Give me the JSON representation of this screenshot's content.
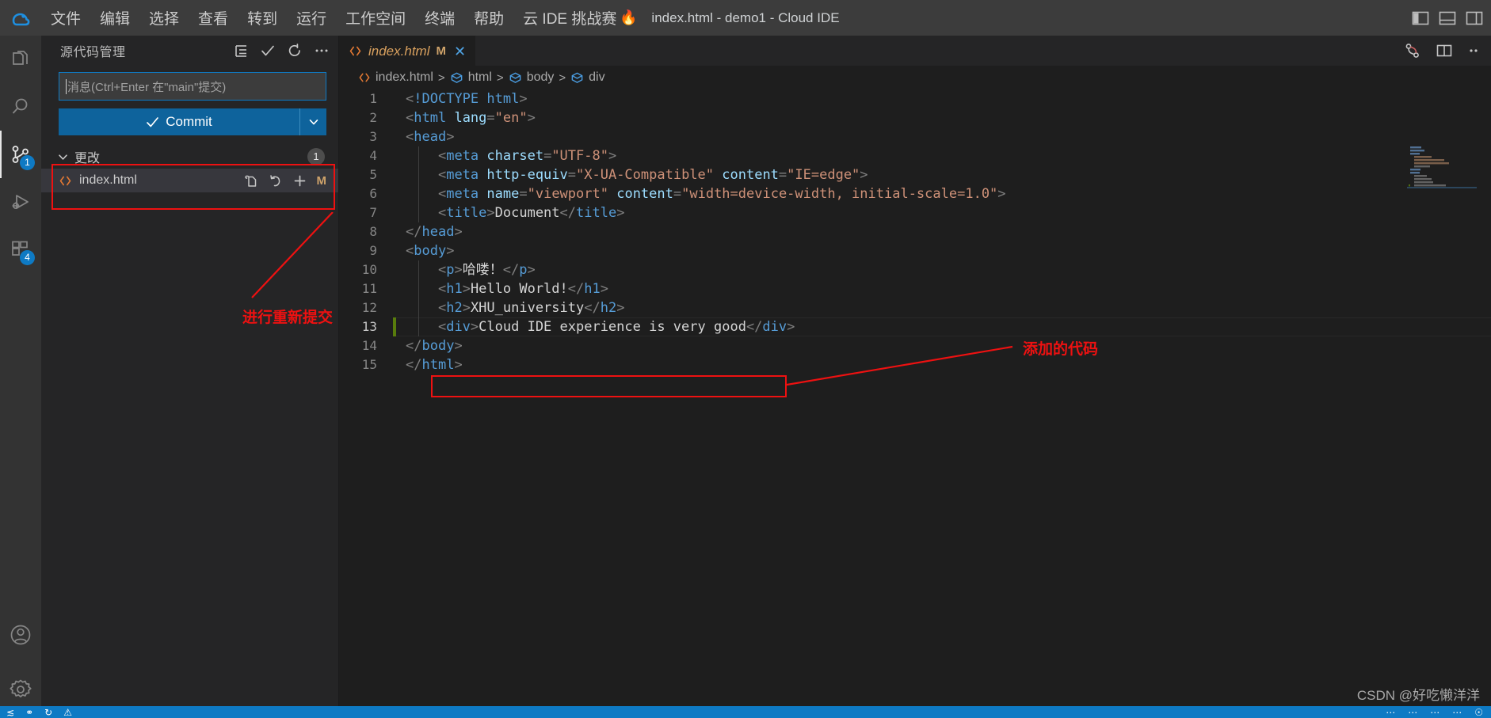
{
  "titlebar": {
    "logo_icon": "cloud-ide-logo",
    "menus": [
      "文件",
      "编辑",
      "选择",
      "查看",
      "转到",
      "运行",
      "工作空间",
      "终端",
      "帮助"
    ],
    "challenge_label": "云 IDE 挑战赛",
    "challenge_emoji": "🔥",
    "window_title": "index.html - demo1 - Cloud IDE",
    "layout_buttons": [
      "toggle-primary-sidebar-icon",
      "toggle-panel-icon",
      "toggle-secondary-sidebar-icon"
    ]
  },
  "activitybar": {
    "items": [
      {
        "name": "explorer",
        "icon": "files-icon",
        "badge": ""
      },
      {
        "name": "search",
        "icon": "search-icon",
        "badge": ""
      },
      {
        "name": "source-control",
        "icon": "source-control-icon",
        "badge": "1"
      },
      {
        "name": "run-debug",
        "icon": "run-debug-icon",
        "badge": ""
      },
      {
        "name": "extensions",
        "icon": "extensions-icon",
        "badge": "4"
      }
    ],
    "bottom": [
      {
        "name": "account",
        "icon": "account-icon"
      },
      {
        "name": "manage",
        "icon": "gear-icon"
      }
    ]
  },
  "sidebar": {
    "title": "源代码管理",
    "actions": [
      "view-as-tree-icon",
      "commit-check-icon",
      "refresh-icon",
      "more-actions-icon"
    ],
    "commit_input_placeholder": "消息(Ctrl+Enter 在\"main\"提交)",
    "commit_button_label": "Commit",
    "commit_dropdown_icon": "chevron-down-icon",
    "changes_group": {
      "label": "更改",
      "count": "1",
      "chevron": "chevron-down-icon"
    },
    "files": [
      {
        "name": "index.html",
        "icon": "html-file-icon",
        "actions": [
          "open-file-icon",
          "discard-changes-icon",
          "stage-changes-icon"
        ],
        "status_letter": "M"
      }
    ]
  },
  "editor": {
    "tab": {
      "icon": "html-file-icon",
      "label": "index.html",
      "status_letter": "M",
      "close_icon": "close-icon"
    },
    "tools": [
      "split-diff-icon",
      "split-editor-icon",
      "more-actions-icon"
    ],
    "breadcrumb": [
      {
        "label": "index.html",
        "icon": "html-file-icon"
      },
      {
        "label": "html",
        "icon": "symbol-cube-icon"
      },
      {
        "label": "body",
        "icon": "symbol-cube-icon"
      },
      {
        "label": "div",
        "icon": "symbol-cube-icon"
      }
    ],
    "separator": ">",
    "active_line": 13,
    "lines": [
      {
        "n": "1",
        "indent": 0,
        "modified": false,
        "tokens": [
          {
            "t": "br",
            "v": "<"
          },
          {
            "t": "doctype",
            "v": "!DOCTYPE html"
          },
          {
            "t": "br",
            "v": ">"
          }
        ]
      },
      {
        "n": "2",
        "indent": 0,
        "modified": false,
        "tokens": [
          {
            "t": "br",
            "v": "<"
          },
          {
            "t": "tag",
            "v": "html"
          },
          {
            "t": "txt",
            "v": " "
          },
          {
            "t": "attr",
            "v": "lang"
          },
          {
            "t": "br",
            "v": "="
          },
          {
            "t": "str",
            "v": "\"en\""
          },
          {
            "t": "br",
            "v": ">"
          }
        ]
      },
      {
        "n": "3",
        "indent": 0,
        "modified": false,
        "tokens": [
          {
            "t": "br",
            "v": "<"
          },
          {
            "t": "tag",
            "v": "head"
          },
          {
            "t": "br",
            "v": ">"
          }
        ]
      },
      {
        "n": "4",
        "indent": 1,
        "modified": false,
        "tokens": [
          {
            "t": "txt",
            "v": "    "
          },
          {
            "t": "br",
            "v": "<"
          },
          {
            "t": "tag",
            "v": "meta"
          },
          {
            "t": "txt",
            "v": " "
          },
          {
            "t": "attr",
            "v": "charset"
          },
          {
            "t": "br",
            "v": "="
          },
          {
            "t": "str",
            "v": "\"UTF-8\""
          },
          {
            "t": "br",
            "v": ">"
          }
        ]
      },
      {
        "n": "5",
        "indent": 1,
        "modified": false,
        "tokens": [
          {
            "t": "txt",
            "v": "    "
          },
          {
            "t": "br",
            "v": "<"
          },
          {
            "t": "tag",
            "v": "meta"
          },
          {
            "t": "txt",
            "v": " "
          },
          {
            "t": "attr",
            "v": "http-equiv"
          },
          {
            "t": "br",
            "v": "="
          },
          {
            "t": "str",
            "v": "\"X-UA-Compatible\""
          },
          {
            "t": "txt",
            "v": " "
          },
          {
            "t": "attr",
            "v": "content"
          },
          {
            "t": "br",
            "v": "="
          },
          {
            "t": "str",
            "v": "\"IE=edge\""
          },
          {
            "t": "br",
            "v": ">"
          }
        ]
      },
      {
        "n": "6",
        "indent": 1,
        "modified": false,
        "tokens": [
          {
            "t": "txt",
            "v": "    "
          },
          {
            "t": "br",
            "v": "<"
          },
          {
            "t": "tag",
            "v": "meta"
          },
          {
            "t": "txt",
            "v": " "
          },
          {
            "t": "attr",
            "v": "name"
          },
          {
            "t": "br",
            "v": "="
          },
          {
            "t": "str",
            "v": "\"viewport\""
          },
          {
            "t": "txt",
            "v": " "
          },
          {
            "t": "attr",
            "v": "content"
          },
          {
            "t": "br",
            "v": "="
          },
          {
            "t": "str",
            "v": "\"width=device-width, initial-scale=1.0\""
          },
          {
            "t": "br",
            "v": ">"
          }
        ]
      },
      {
        "n": "7",
        "indent": 1,
        "modified": false,
        "tokens": [
          {
            "t": "txt",
            "v": "    "
          },
          {
            "t": "br",
            "v": "<"
          },
          {
            "t": "tag",
            "v": "title"
          },
          {
            "t": "br",
            "v": ">"
          },
          {
            "t": "txt",
            "v": "Document"
          },
          {
            "t": "br",
            "v": "</"
          },
          {
            "t": "tag",
            "v": "title"
          },
          {
            "t": "br",
            "v": ">"
          }
        ]
      },
      {
        "n": "8",
        "indent": 0,
        "modified": false,
        "tokens": [
          {
            "t": "br",
            "v": "</"
          },
          {
            "t": "tag",
            "v": "head"
          },
          {
            "t": "br",
            "v": ">"
          }
        ]
      },
      {
        "n": "9",
        "indent": 0,
        "modified": false,
        "tokens": [
          {
            "t": "br",
            "v": "<"
          },
          {
            "t": "tag",
            "v": "body"
          },
          {
            "t": "br",
            "v": ">"
          }
        ]
      },
      {
        "n": "10",
        "indent": 1,
        "modified": false,
        "tokens": [
          {
            "t": "txt",
            "v": "    "
          },
          {
            "t": "br",
            "v": "<"
          },
          {
            "t": "tag",
            "v": "p"
          },
          {
            "t": "br",
            "v": ">"
          },
          {
            "t": "txt",
            "v": "哈喽！"
          },
          {
            "t": "br",
            "v": "</"
          },
          {
            "t": "tag",
            "v": "p"
          },
          {
            "t": "br",
            "v": ">"
          }
        ]
      },
      {
        "n": "11",
        "indent": 1,
        "modified": false,
        "tokens": [
          {
            "t": "txt",
            "v": "    "
          },
          {
            "t": "br",
            "v": "<"
          },
          {
            "t": "tag",
            "v": "h1"
          },
          {
            "t": "br",
            "v": ">"
          },
          {
            "t": "txt",
            "v": "Hello World!"
          },
          {
            "t": "br",
            "v": "</"
          },
          {
            "t": "tag",
            "v": "h1"
          },
          {
            "t": "br",
            "v": ">"
          }
        ]
      },
      {
        "n": "12",
        "indent": 1,
        "modified": false,
        "tokens": [
          {
            "t": "txt",
            "v": "    "
          },
          {
            "t": "br",
            "v": "<"
          },
          {
            "t": "tag",
            "v": "h2"
          },
          {
            "t": "br",
            "v": ">"
          },
          {
            "t": "txt",
            "v": "XHU_university"
          },
          {
            "t": "br",
            "v": "</"
          },
          {
            "t": "tag",
            "v": "h2"
          },
          {
            "t": "br",
            "v": ">"
          }
        ]
      },
      {
        "n": "13",
        "indent": 1,
        "modified": true,
        "tokens": [
          {
            "t": "txt",
            "v": "    "
          },
          {
            "t": "br",
            "v": "<"
          },
          {
            "t": "tag",
            "v": "div"
          },
          {
            "t": "br",
            "v": ">"
          },
          {
            "t": "txt",
            "v": "Cloud IDE experience is very good"
          },
          {
            "t": "br",
            "v": "</"
          },
          {
            "t": "tag",
            "v": "div"
          },
          {
            "t": "br",
            "v": ">"
          }
        ]
      },
      {
        "n": "14",
        "indent": 0,
        "modified": false,
        "tokens": [
          {
            "t": "br",
            "v": "</"
          },
          {
            "t": "tag",
            "v": "body"
          },
          {
            "t": "br",
            "v": ">"
          }
        ]
      },
      {
        "n": "15",
        "indent": 0,
        "modified": false,
        "tokens": [
          {
            "t": "br",
            "v": "</"
          },
          {
            "t": "tag",
            "v": "html"
          },
          {
            "t": "br",
            "v": ">"
          }
        ]
      }
    ]
  },
  "annotations": [
    {
      "name": "recommit-annotation",
      "text": "进行重新提交",
      "color": "#ee1111"
    },
    {
      "name": "added-code-annotation",
      "text": "添加的代码",
      "color": "#ee1111"
    }
  ],
  "statusbar": {
    "background": "#0e7ac4",
    "left_items": [
      "remote-icon",
      "branch-icon",
      "sync-icon",
      "warning-icon"
    ],
    "right_items": [
      "line-col",
      "spaces",
      "encoding",
      "eol",
      "language",
      "bell-icon"
    ]
  },
  "watermark": "CSDN @好吃懒洋洋",
  "colors": {
    "titlebar_bg": "#3c3c3c",
    "activitybar_bg": "#333333",
    "sidebar_bg": "#252526",
    "editor_bg": "#1e1e1e",
    "accent_blue": "#0e7ac4",
    "commit_button": "#0e639c",
    "badge_blue": "#0e7ac4",
    "annotation_red": "#ee1111",
    "modified_gutter": "#587c0c",
    "tag_color": "#569cd6",
    "attr_color": "#9cdcfe",
    "string_color": "#ce9178",
    "text_color": "#d4d4d4",
    "bracket_color": "#808080"
  }
}
